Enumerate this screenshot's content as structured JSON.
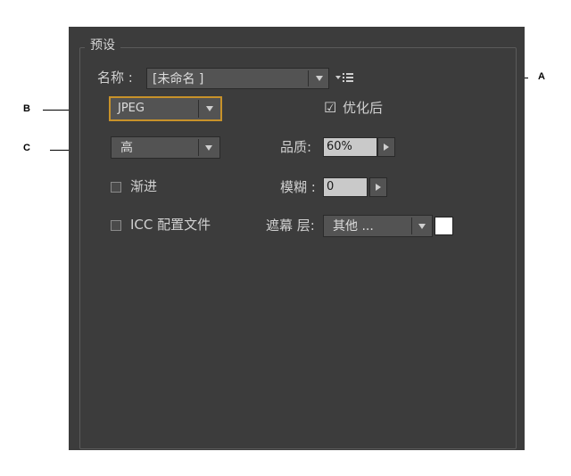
{
  "preset": {
    "group_label": "预设",
    "name_label": "名称 :",
    "name_value": "[未命名 ]"
  },
  "format": {
    "value": "JPEG"
  },
  "quality_preset": {
    "value": "高"
  },
  "optimized": {
    "label": "优化后",
    "checked": true
  },
  "quality": {
    "label": "品质:",
    "value": "60%"
  },
  "blur": {
    "label": "模糊 :",
    "value": "0"
  },
  "progressive": {
    "label": "渐进",
    "checked": false
  },
  "icc_profile": {
    "label": "ICC 配置文件",
    "checked": false
  },
  "matte": {
    "label": "遮幕 层:",
    "value": "其他 ...",
    "color": "#ffffff"
  },
  "callouts": {
    "a": "A",
    "b": "B",
    "c": "C"
  },
  "colors": {
    "panel_bg": "#3c3c3c",
    "focus_border": "#c8922a"
  }
}
